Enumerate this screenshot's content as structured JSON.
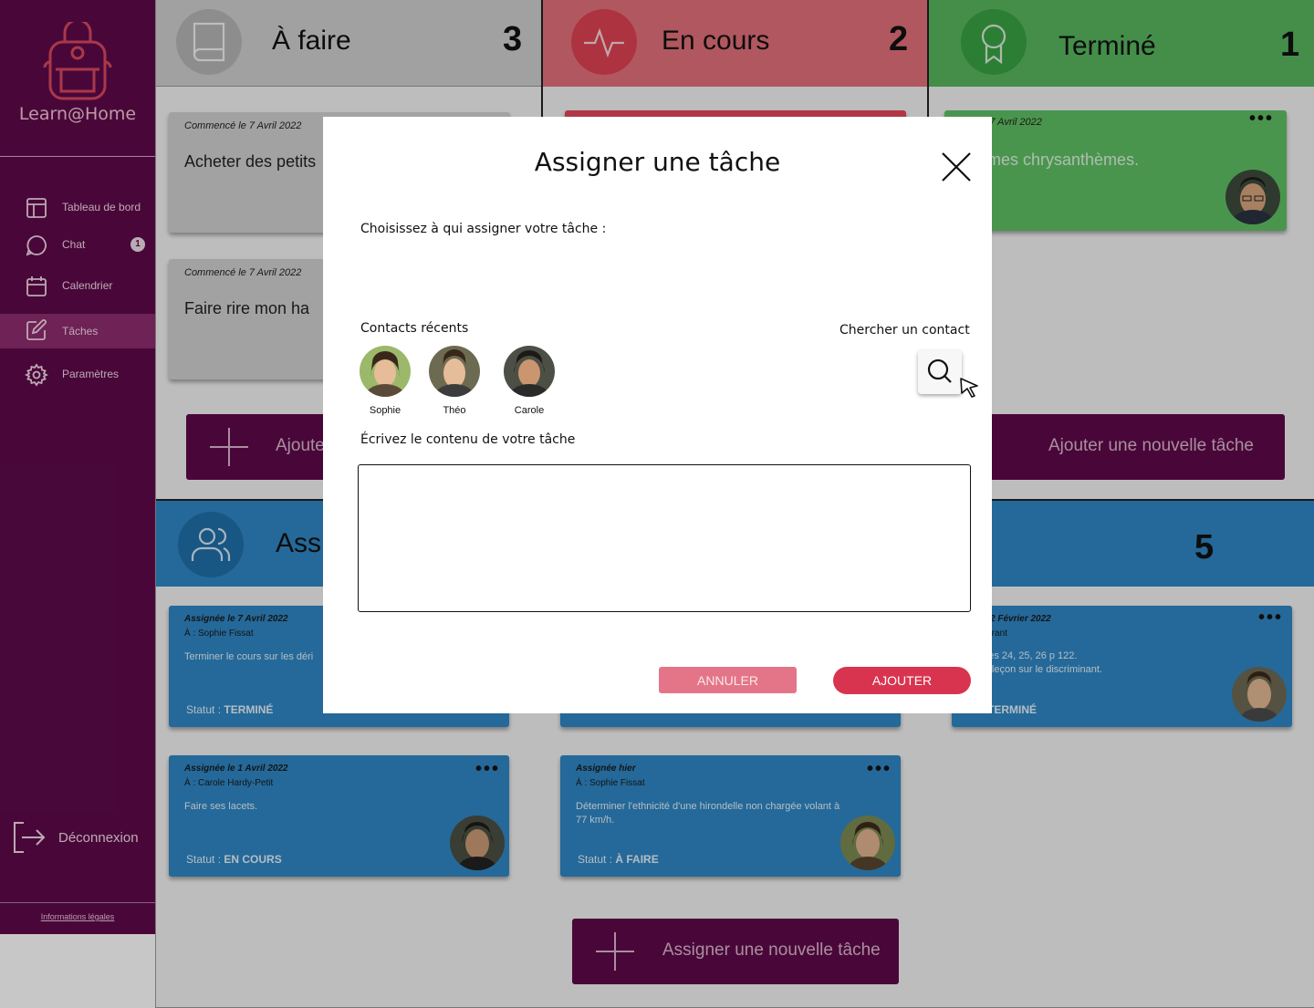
{
  "app": {
    "name": "Learn@Home"
  },
  "sidebar": {
    "items": [
      {
        "label": "Tableau de bord",
        "icon": "dashboard-icon"
      },
      {
        "label": "Chat",
        "icon": "chat-icon",
        "badge": "1"
      },
      {
        "label": "Calendrier",
        "icon": "calendar-icon"
      },
      {
        "label": "Tâches",
        "icon": "edit-icon",
        "active": true
      },
      {
        "label": "Paramètres",
        "icon": "gear-icon"
      }
    ],
    "logout_label": "Déconnexion",
    "legal_label": "Informations légales"
  },
  "columns": [
    {
      "title": "À faire",
      "count": "3",
      "color": "#cfcfcf",
      "icon": "book-icon"
    },
    {
      "title": "En cours",
      "count": "2",
      "color": "#e3707a",
      "icon": "activity-icon"
    },
    {
      "title": "Terminé",
      "count": "1",
      "color": "#58b75f",
      "icon": "award-icon"
    }
  ],
  "todo_cards": [
    {
      "date": "Commencé le 7 Avril 2022",
      "text": "Acheter des petits"
    },
    {
      "date": "Commencé le 7 Avril 2022",
      "text": "Faire rire mon ha"
    }
  ],
  "done_card": {
    "date": "ncé le 7 Avril 2022",
    "text": "ser mes chrysanthèmes."
  },
  "add_task_labels": {
    "left": "Ajoute",
    "right": "Ajouter une nouvelle tâche"
  },
  "assigned": {
    "title": "Ass",
    "count": "5",
    "icon": "users-icon",
    "cards": [
      {
        "date": "Assignée le 7 Avril 2022",
        "to": "À : Sophie Fissat",
        "body": "Terminer le cours sur les déri",
        "status_prefix": "Statut :",
        "status": "TERMINÉ"
      },
      {
        "date": "ée le 2 Février 2022",
        "to": "o Courant",
        "body": "ercices 24, 25, 26 p 122.\nevoir leçon sur le discriminant.",
        "status_prefix": "ut :",
        "status": "TERMINÉ"
      },
      {
        "date": "Assignée le 1 Avril 2022",
        "to": "À : Carole Hardy-Petit",
        "body": "Faire ses lacets.",
        "status_prefix": "Statut :",
        "status": "EN COURS"
      },
      {
        "date": "Assignée hier",
        "to": "À : Sophie Fissat",
        "body": "Déterminer l'ethnicité d'une hirondelle non chargée volant à 77 km/h.",
        "status_prefix": "Statut :",
        "status": "À FAIRE"
      }
    ],
    "assign_button": "Assigner une nouvelle tâche"
  },
  "modal": {
    "title": "Assigner une tâche",
    "choose_label": "Choisissez à qui assigner votre tâche :",
    "recent_label": "Contacts récents",
    "search_label": "Chercher un contact",
    "contacts": [
      {
        "name": "Sophie"
      },
      {
        "name": "Théo"
      },
      {
        "name": "Carole"
      }
    ],
    "content_label": "Écrivez le contenu de votre tâche",
    "content_value": "",
    "cancel_label": "ANNULER",
    "add_label": "AJOUTER"
  },
  "colors": {
    "sidebar": "#5e0a4a",
    "sidebar_active": "#8f2c6d",
    "assigned_blue": "#2f87c5",
    "cancel": "#e47588",
    "add": "#d8344f"
  }
}
